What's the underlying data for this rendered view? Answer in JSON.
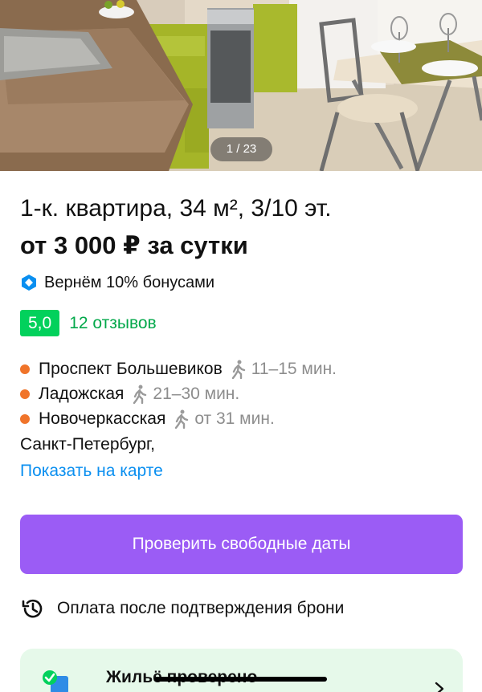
{
  "gallery": {
    "counter": "1 / 23"
  },
  "listing": {
    "title": "1-к. квартира, 34 м², 3/10 эт.",
    "price": "от 3 000 ₽ за сутки",
    "bonus_text": "Вернём 10% бонусами",
    "rating": "5,0",
    "reviews": "12 отзывов"
  },
  "metro": [
    {
      "name": "Проспект Большевиков",
      "time": "11–15 мин."
    },
    {
      "name": "Ладожская",
      "time": "21–30 мин."
    },
    {
      "name": "Новочеркасская",
      "time": "от 31 мин."
    }
  ],
  "address": {
    "city": "Санкт-Петербург,",
    "map_link": "Показать на карте"
  },
  "actions": {
    "check_dates": "Проверить свободные даты",
    "payment_note": "Оплата после подтверждения брони"
  },
  "verified": {
    "title": "Жильё проверено"
  },
  "colors": {
    "accent_purple": "#9b5cf5",
    "rating_green": "#02d15c",
    "link_blue": "#0a8ff0",
    "metro_orange": "#f0742a",
    "verified_bg": "#e6f9ea"
  }
}
